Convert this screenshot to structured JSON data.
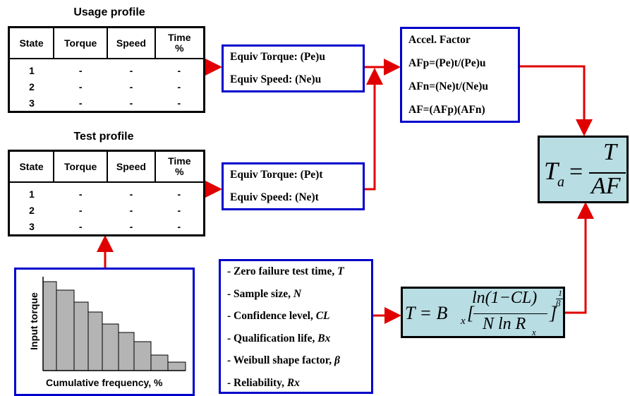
{
  "usage_profile": {
    "title": "Usage profile",
    "headers": [
      "State",
      "Torque",
      "Speed",
      "Time\n%"
    ],
    "rows": [
      [
        "1",
        "-",
        "-",
        "-"
      ],
      [
        "2",
        "-",
        "-",
        "-"
      ],
      [
        "3",
        "-",
        "-",
        "-"
      ]
    ]
  },
  "test_profile": {
    "title": "Test profile",
    "headers": [
      "State",
      "Torque",
      "Speed",
      "Time\n%"
    ],
    "rows": [
      [
        "1",
        "-",
        "-",
        "-"
      ],
      [
        "2",
        "-",
        "-",
        "-"
      ],
      [
        "3",
        "-",
        "-",
        "-"
      ]
    ]
  },
  "usage_equiv": {
    "torque": "Equiv Torque: (Pe)u",
    "speed": "Equiv Speed: (Ne)u"
  },
  "test_equiv": {
    "torque": "Equiv Torque: (Pe)t",
    "speed": "Equiv Speed: (Ne)t"
  },
  "accel_factor": {
    "title": "Accel. Factor",
    "lines": [
      "AFp=(Pe)t/(Pe)u",
      "AFn=(Ne)t/(Ne)u",
      "AF=(AFp)(AFn)"
    ]
  },
  "test_time_formula": {
    "lhs": "T",
    "sub": "a",
    "num": "T",
    "den": "AF"
  },
  "zero_failure_formula": {
    "lhs": "T = B",
    "sub": "x",
    "num": "ln(1−CL)",
    "den_n": "N ln R",
    "den_sub": "x",
    "exp_num": "1",
    "exp_den": "β"
  },
  "inputs": [
    {
      "text": "- Zero failure test time, ",
      "sym": "T"
    },
    {
      "text": "- Sample size, ",
      "sym": "N"
    },
    {
      "text": "- Confidence level, ",
      "sym": "CL"
    },
    {
      "text": "- Qualification life, ",
      "sym": "Bx"
    },
    {
      "text": "- Weibull shape factor, ",
      "sym": "β"
    },
    {
      "text": "- Reliability, ",
      "sym": "Rx"
    }
  ],
  "colors": {
    "arrow": "#e00000",
    "box_border": "#0000cc",
    "formula_bg": "#b8dde3",
    "bar": "#b4b4b4"
  },
  "chart_data": {
    "type": "bar",
    "xlabel": "Cumulative frequency, %",
    "ylabel": "Input torque",
    "values": [
      126,
      114,
      97,
      83,
      66,
      54,
      41,
      22,
      12
    ],
    "widths": [
      19,
      25,
      20,
      20,
      23,
      22,
      24,
      24,
      25
    ]
  }
}
